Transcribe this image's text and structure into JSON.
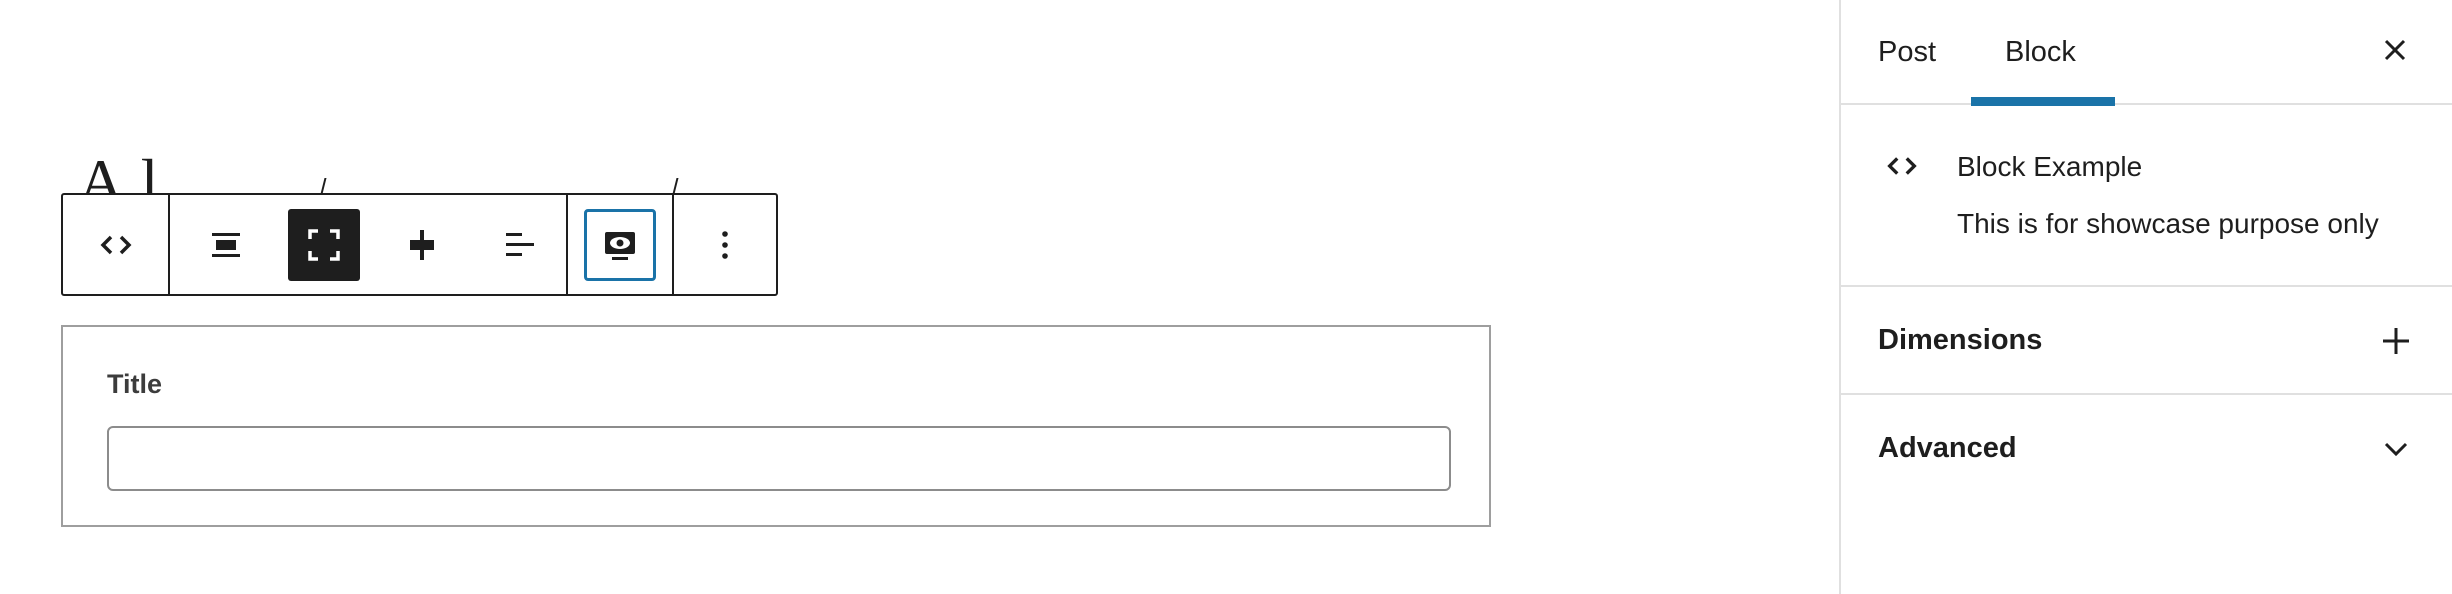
{
  "editor": {
    "underlying_text": "A l",
    "toolbar": {
      "buttons": [
        {
          "name": "block-type",
          "icon": "code-brackets-icon"
        },
        {
          "name": "align-wide",
          "icon": "align-wide-icon"
        },
        {
          "name": "align-full",
          "icon": "fullscreen-icon",
          "active": true
        },
        {
          "name": "justify-center",
          "icon": "justify-center-icon"
        },
        {
          "name": "align-left",
          "icon": "align-left-icon"
        },
        {
          "name": "preview",
          "icon": "preview-eye-icon",
          "focused": true
        },
        {
          "name": "more-options",
          "icon": "vertical-ellipsis-icon"
        }
      ]
    },
    "block": {
      "label": "Title",
      "input_value": ""
    }
  },
  "sidebar": {
    "tabs": [
      {
        "label": "Post",
        "active": false
      },
      {
        "label": "Block",
        "active": true
      }
    ],
    "block_card": {
      "title": "Block Example",
      "description": "This is for showcase purpose only",
      "icon": "code-brackets-icon"
    },
    "panels": [
      {
        "title": "Dimensions",
        "toggle_icon": "plus-icon"
      },
      {
        "title": "Advanced",
        "toggle_icon": "chevron-down-icon"
      }
    ]
  },
  "colors": {
    "accent": "#1a73a8",
    "text": "#1e1e1e",
    "border": "#e0e0e0"
  }
}
